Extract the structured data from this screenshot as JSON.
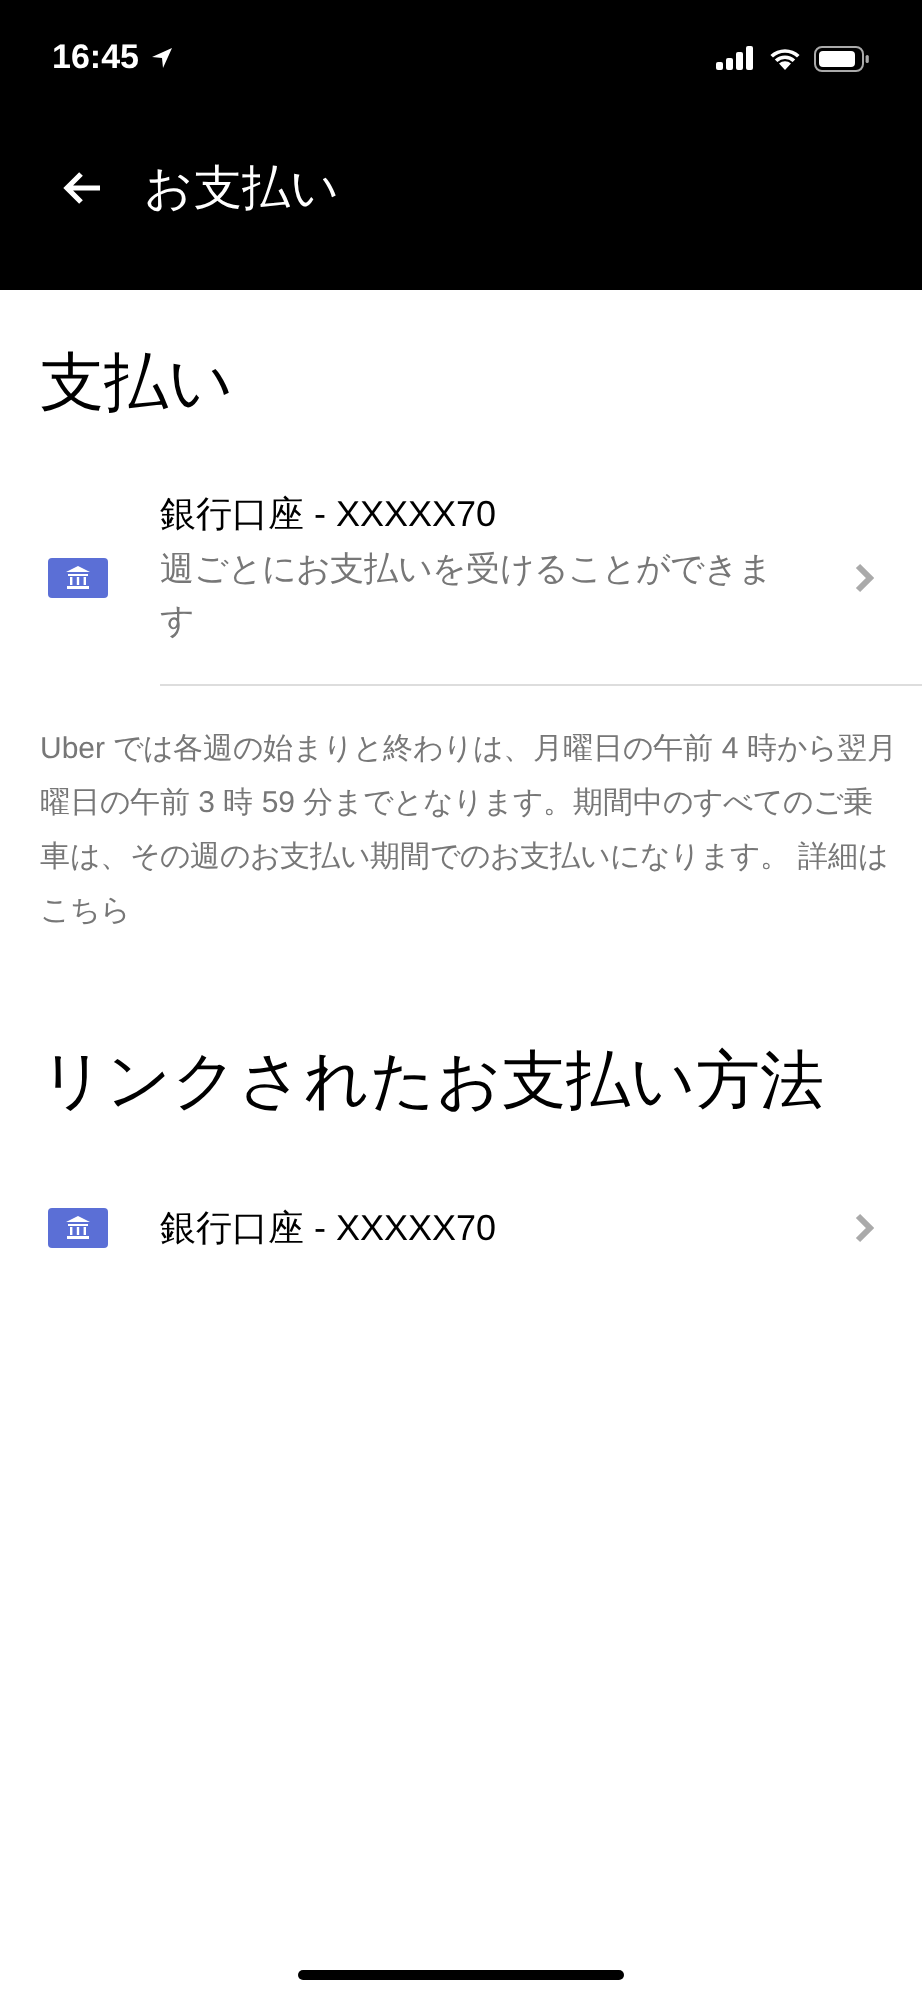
{
  "status_bar": {
    "time": "16:45"
  },
  "nav": {
    "title": "お支払い"
  },
  "payout": {
    "heading": "支払い",
    "account": {
      "title": "銀行口座 - XXXXX70",
      "subtitle": "週ごとにお支払いを受けることができます"
    },
    "note": "Uber では各週の始まりと終わりは、月曜日の午前 4 時から翌月曜日の午前 3 時 59 分までとなります。期間中のすべてのご乗車は、その週のお支払い期間でのお支払いになります。 詳細はこちら"
  },
  "linked": {
    "heading": "リンクされたお支払い方法",
    "methods": [
      {
        "title": "銀行口座 - XXXXX70"
      }
    ]
  }
}
